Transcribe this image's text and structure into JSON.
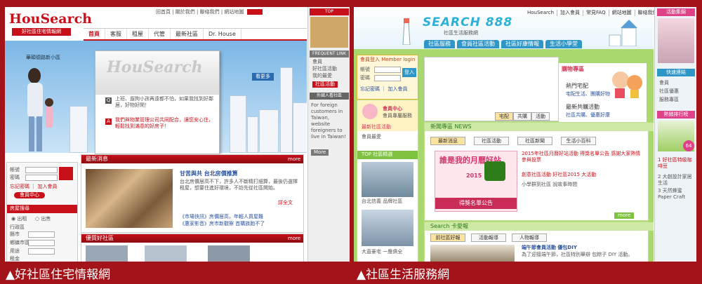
{
  "left_site": {
    "logo": "HouSearch",
    "logo_sub": "好社區住宅情報網",
    "top_links": "回首頁 | 關於我們 | 聯絡我們 | 網站地圖",
    "nav": [
      "首頁",
      "客服",
      "租屋",
      "代管",
      "最新社區",
      "Dr. House"
    ],
    "hero_tagline": "華碩德路新小區",
    "popup_watermark": "HouSearch",
    "popup_q": "上班、遛狗小孩再遠都不怕，如果我找到好鄰居，好物好閑！",
    "popup_a": "我們與物業管理公司共同配合，讓您安心住，輕鬆找到滿意的好房子！",
    "popup_button": "看更多",
    "sidebar_top": "TOP",
    "frequent_link_title": "FREQUENT LINK",
    "frequent_links": [
      "會員",
      "好社區活動",
      "我的最愛"
    ],
    "sidebar_button": "社區活動",
    "foreigner_title": "外國人看社區",
    "foreigner_text": "For foreign customers in Taiwan, website foreigners to live in Taiwan!",
    "sidebar_more": "More",
    "login_account": "帳號",
    "login_password": "密碼",
    "login_links": "忘記密碼 ｜ 加入會員",
    "login_button": "會員中心",
    "search_title": "房屋搜尋",
    "search_options": [
      "出租",
      "出售"
    ],
    "search_fields": [
      "行政區",
      "縣市",
      "鄉鎮市區",
      "用途",
      "租金"
    ],
    "news_title": "最新消息",
    "news_more": "more",
    "news_headline": "甘苦與共 台北房價推算",
    "news_body": "台北房價居高不下，許多人不斷精打細算，最後仍選擇租屋，想要住進好環境，不妨先從社區開始。",
    "news_more_link": "詳全文",
    "news_items": [
      "《市場快訊》房價居高，年輕人買屋難",
      "《惠家影音》房市新觀察 首購族跑不了"
    ],
    "shop_title": "優質好社區",
    "shop_more": "more"
  },
  "right_site": {
    "logo": "SEARCH 888",
    "logo_sub": "社區生活服務網",
    "top_links": [
      "HouSearch",
      "加入會員",
      "常見FAQ",
      "網站地圖",
      "聯絡我們"
    ],
    "nav": [
      "社區服務",
      "會員社區活動",
      "社區好康情報",
      "生活小學堂"
    ],
    "member_login": "會員登入 Member login",
    "member_account": "帳號",
    "member_password": "密碼",
    "member_links": "忘記密碼 ｜ 加入會員",
    "member_button": "登入",
    "promo_title": "購物專區",
    "promo_hot": "熱門宅配",
    "promo_hot_sub": "宅配生活、團購好物",
    "promo_latest": "最新共購活動",
    "promo_latest_sub": "社區共購、優惠好康",
    "banner_tabs": [
      "宅配",
      "共購",
      "活動"
    ],
    "bubble_center": "會員中心",
    "bubble_sub": "會員專屬服務",
    "latest_activity": "最新社區活動",
    "fav": "會員最愛",
    "news_title": "新聞專區 NEWS",
    "news_tabs": [
      "最新消息",
      "社區活動",
      "社區新聞",
      "生活小百科"
    ],
    "poster_title": "誰是我的月曆好站",
    "poster_year": "2015",
    "poster_caption": "得獎名單公告",
    "news_items": [
      "2015年社區月曆好站活動 得獎名單公告 感謝大家熱情參與投票",
      "創意社區活動 好社區2015 大活動",
      "小學群到社區 說故事時間"
    ],
    "news_more": "more",
    "search_title": "Search 卡愛報",
    "search_tabs": [
      "前社區好報",
      "活動報導",
      "人物報導"
    ],
    "search_item_title": "端午節會員活動 優包DIY",
    "search_item_body": "為了迎接端午節，社區特別舉辦 包粽子 DIY 活動。",
    "top_title": "TOP 社區精選",
    "top_captions": [
      "台北信義 品牌社區",
      "大直豪宅 一應俱全"
    ],
    "side_latest": "活動集錦",
    "side_menu_title": "快速連結",
    "side_links": [
      "會員",
      "社區優惠",
      "服務專區"
    ],
    "side_hot_title": "熱銷排行榜",
    "side_hot_items": [
      "1 好社區特級咖啡豆",
      "2 大創設計家居生活",
      "3 天然蜂蜜Paper Craft"
    ],
    "side_price": "64"
  },
  "captions": {
    "left": "▲好社區住宅情報網",
    "right": "▲社區生活服務網"
  },
  "colors": {
    "frame": "#a3131a",
    "left_accent": "#c8101a",
    "right_accent": "#2f97c8",
    "right_green": "#a9d96e"
  }
}
